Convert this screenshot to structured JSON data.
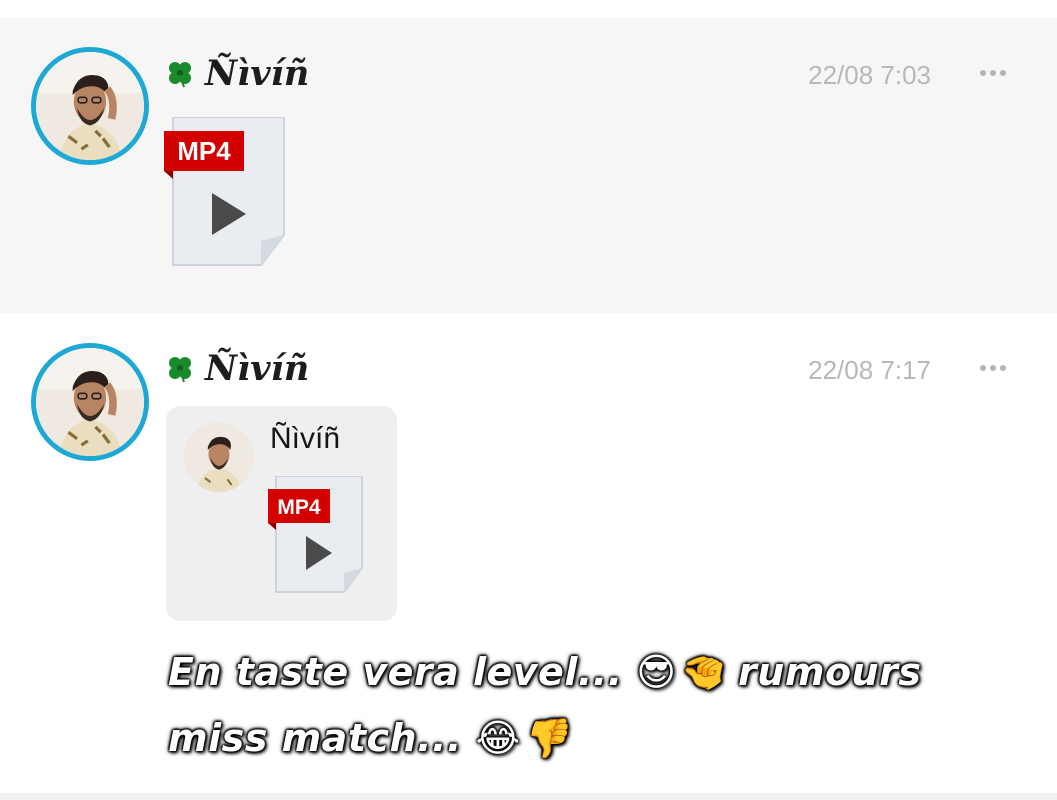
{
  "messages": [
    {
      "sender": "Ñìvíñ",
      "time": "22/08 7:03",
      "attachment": {
        "type_label": "MP4",
        "icon": "video-play-icon"
      }
    },
    {
      "sender": "Ñìvíñ",
      "time": "22/08 7:17",
      "quoted": {
        "sender": "Ñìvíñ",
        "attachment": {
          "type_label": "MP4",
          "icon": "video-play-icon"
        }
      },
      "caption": "En taste vera level... 😎🤏 rumours miss match... 😂👎"
    }
  ],
  "icons": {
    "sender_badge": "clover-icon",
    "more_actions": "more-options-icon"
  },
  "colors": {
    "avatar_ring": "#1ea8d6",
    "mp4_badge": "#d40000",
    "timestamp": "#b8b8b8"
  }
}
